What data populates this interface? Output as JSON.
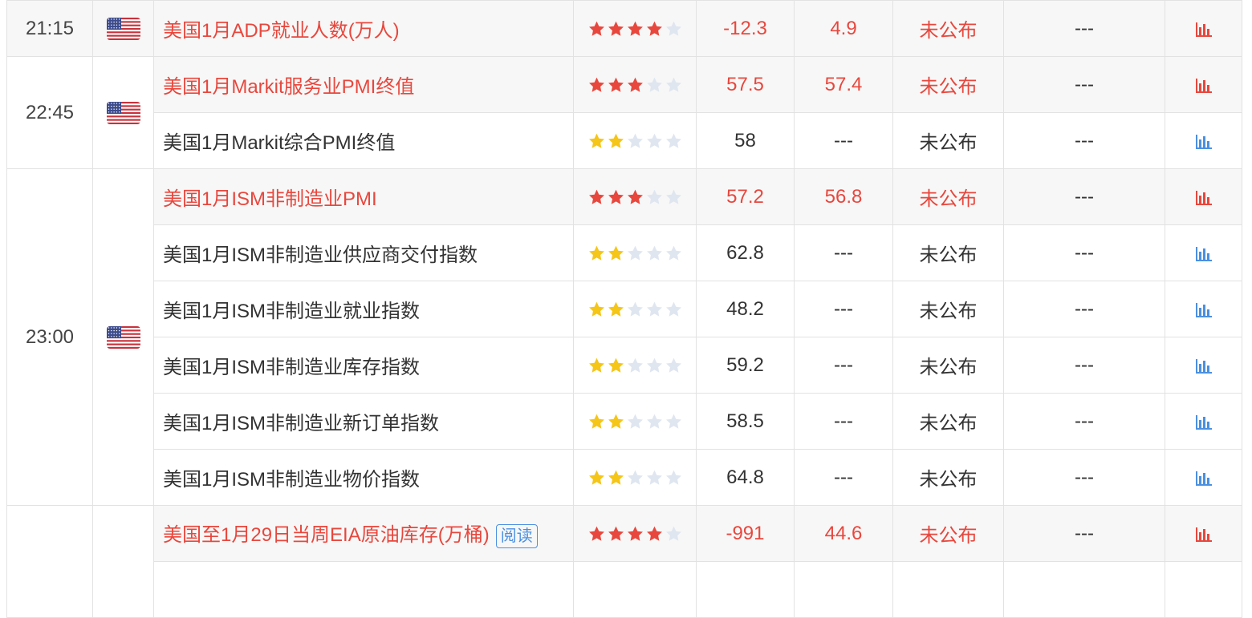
{
  "colors": {
    "important": "#e8473d",
    "normal": "#333333",
    "star_red": "#e8473d",
    "star_yellow": "#f5c518",
    "star_empty": "#dfe6f0",
    "chart_red": "#e8473d",
    "chart_blue": "#4a90e2"
  },
  "groups": [
    {
      "time": "21:15",
      "flag_icon": "us-flag-icon",
      "events": [
        {
          "name": "美国1月ADP就业人数(万人)",
          "important": true,
          "stars": 4,
          "previous": "-12.3",
          "forecast": "4.9",
          "actual": "未公布",
          "impact": "---",
          "chart_icon": "bar-chart-icon",
          "stripe": true
        }
      ]
    },
    {
      "time": "22:45",
      "flag_icon": "us-flag-icon",
      "events": [
        {
          "name": "美国1月Markit服务业PMI终值",
          "important": true,
          "stars": 3,
          "previous": "57.5",
          "forecast": "57.4",
          "actual": "未公布",
          "impact": "---",
          "chart_icon": "bar-chart-icon",
          "stripe": true
        },
        {
          "name": "美国1月Markit综合PMI终值",
          "important": false,
          "stars": 2,
          "previous": "58",
          "forecast": "---",
          "actual": "未公布",
          "impact": "---",
          "chart_icon": "bar-chart-icon",
          "stripe": false
        }
      ]
    },
    {
      "time": "23:00",
      "flag_icon": "us-flag-icon",
      "events": [
        {
          "name": "美国1月ISM非制造业PMI",
          "important": true,
          "stars": 3,
          "previous": "57.2",
          "forecast": "56.8",
          "actual": "未公布",
          "impact": "---",
          "chart_icon": "bar-chart-icon",
          "stripe": true
        },
        {
          "name": "美国1月ISM非制造业供应商交付指数",
          "important": false,
          "stars": 2,
          "previous": "62.8",
          "forecast": "---",
          "actual": "未公布",
          "impact": "---",
          "chart_icon": "bar-chart-icon",
          "stripe": false
        },
        {
          "name": "美国1月ISM非制造业就业指数",
          "important": false,
          "stars": 2,
          "previous": "48.2",
          "forecast": "---",
          "actual": "未公布",
          "impact": "---",
          "chart_icon": "bar-chart-icon",
          "stripe": false
        },
        {
          "name": "美国1月ISM非制造业库存指数",
          "important": false,
          "stars": 2,
          "previous": "59.2",
          "forecast": "---",
          "actual": "未公布",
          "impact": "---",
          "chart_icon": "bar-chart-icon",
          "stripe": false
        },
        {
          "name": "美国1月ISM非制造业新订单指数",
          "important": false,
          "stars": 2,
          "previous": "58.5",
          "forecast": "---",
          "actual": "未公布",
          "impact": "---",
          "chart_icon": "bar-chart-icon",
          "stripe": false
        },
        {
          "name": "美国1月ISM非制造业物价指数",
          "important": false,
          "stars": 2,
          "previous": "64.8",
          "forecast": "---",
          "actual": "未公布",
          "impact": "---",
          "chart_icon": "bar-chart-icon",
          "stripe": false
        }
      ]
    },
    {
      "time": "",
      "flag_icon": "",
      "events": [
        {
          "name": "美国至1月29日当周EIA原油库存(万桶)",
          "important": true,
          "stars": 4,
          "previous": "-991",
          "forecast": "44.6",
          "actual": "未公布",
          "impact": "---",
          "chart_icon": "bar-chart-icon",
          "stripe": true,
          "badge": "阅读"
        },
        {
          "name": "",
          "important": false,
          "stars": 0,
          "previous": "",
          "forecast": "",
          "actual": "",
          "impact": "",
          "chart_icon": "",
          "stripe": false
        }
      ]
    }
  ]
}
